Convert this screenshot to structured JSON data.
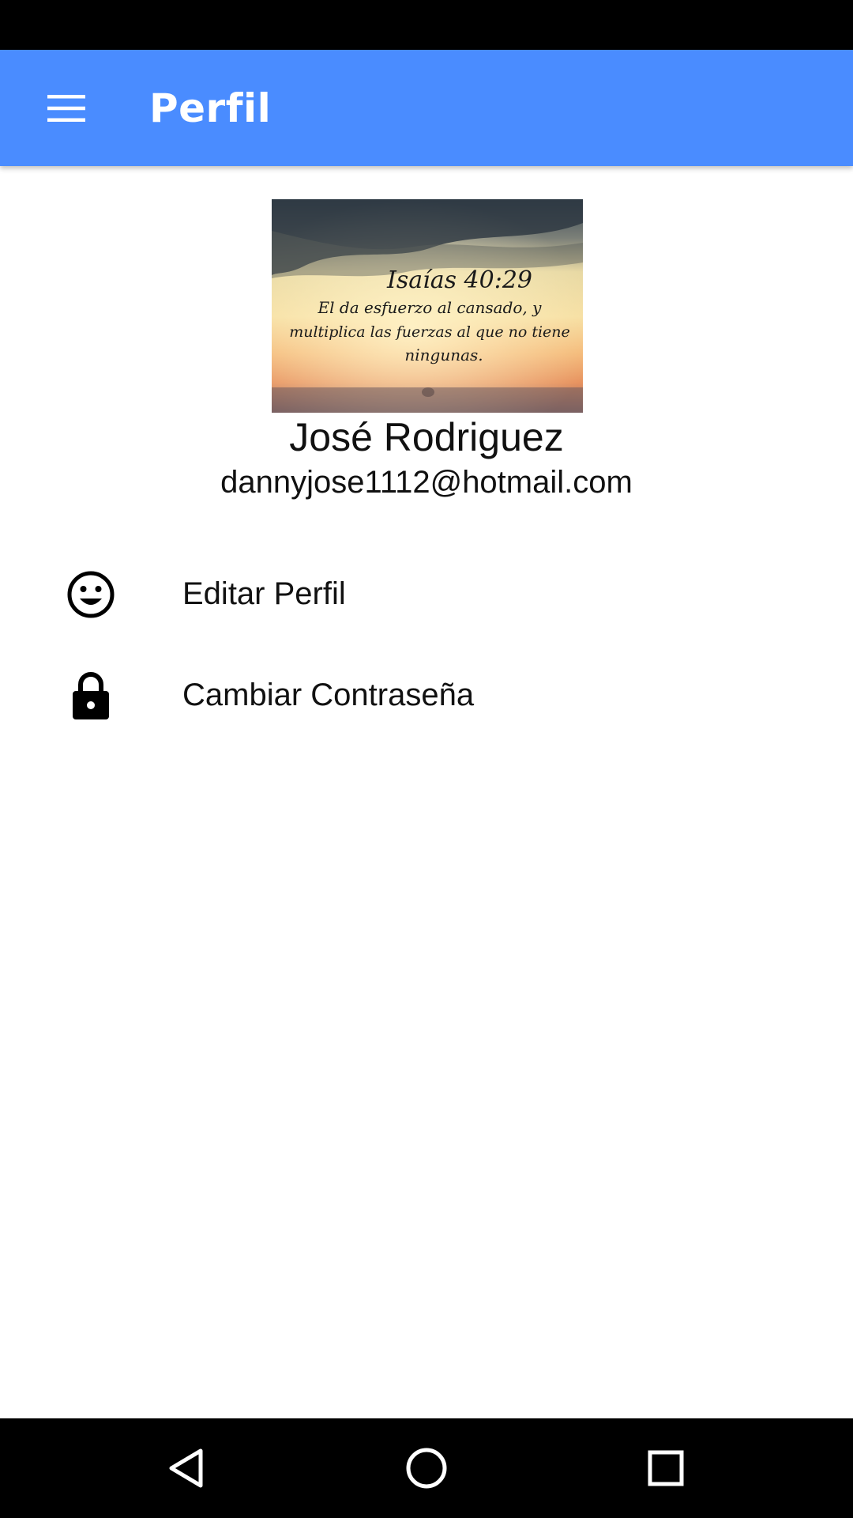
{
  "app_bar": {
    "title": "Perfil",
    "background": "#4a8cff",
    "menu_icon": "hamburger-menu-icon"
  },
  "profile": {
    "image": {
      "verse_reference": "Isaías 40:29",
      "verse_text_line1": "El da esfuerzo al cansado, y",
      "verse_text_line2": "multiplica las fuerzas al que no tiene",
      "verse_text_line3": "ningunas."
    },
    "name": "José Rodriguez",
    "email": "dannyjose1112@hotmail.com"
  },
  "menu": {
    "items": [
      {
        "label": "Editar Perfil",
        "icon": "smiley-face-icon"
      },
      {
        "label": "Cambiar Contraseña",
        "icon": "lock-icon"
      }
    ]
  },
  "system_nav": {
    "back_icon": "back-triangle-icon",
    "home_icon": "home-circle-icon",
    "recents_icon": "recents-square-icon"
  }
}
